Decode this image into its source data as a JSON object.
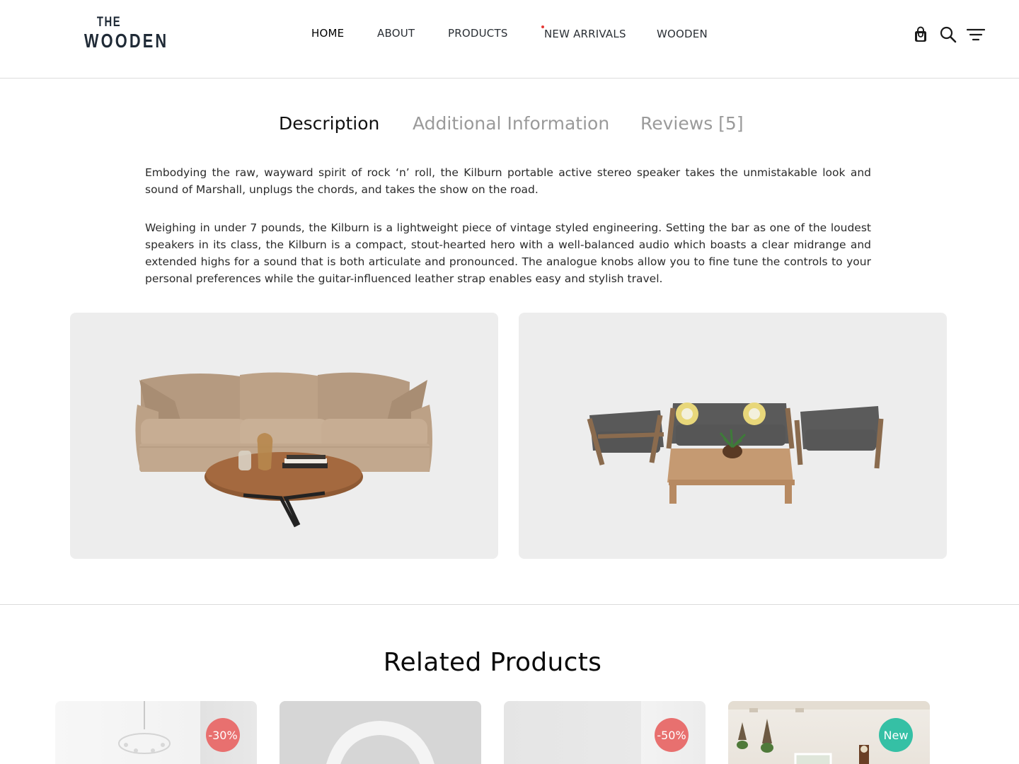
{
  "brand": {
    "line1": "THE",
    "line2": "WOODEN"
  },
  "nav": [
    {
      "label": "HOME"
    },
    {
      "label": "ABOUT"
    },
    {
      "label": "PRODUCTS"
    },
    {
      "label": "NEW ARRIVALS"
    },
    {
      "label": "WOODEN"
    }
  ],
  "header_icons": [
    "shopping-bag-icon",
    "search-icon",
    "filter-menu-icon"
  ],
  "tabs": [
    {
      "label": "Description",
      "active": true
    },
    {
      "label": "Additional Information",
      "active": false
    },
    {
      "label": "Reviews [5]",
      "active": false
    }
  ],
  "description": {
    "p1": "Embodying the raw, wayward spirit of rock ‘n’ roll, the Kilburn portable active stereo speaker takes the unmistakable look and sound of Marshall, unplugs the chords, and takes the show on the road.",
    "p2": "Weighing in under 7 pounds, the Kilburn is a lightweight piece of vintage styled engineering. Setting the bar as one of the loudest speakers in its class, the Kilburn is a compact, stout-hearted hero with a well-balanced audio which boasts a clear midrange and extended highs for a sound that is both articulate and pronounced. The analogue knobs allow you to fine tune the controls to your personal preferences while the guitar-influenced leather strap enables easy and stylish travel."
  },
  "related": {
    "title": "Related Products",
    "cards": [
      {
        "badge": "-30%",
        "badge_color": "#e8706f"
      },
      {
        "badge": "",
        "badge_color": ""
      },
      {
        "badge": "-50%",
        "badge_color": "#e8706f"
      },
      {
        "badge": "New",
        "badge_color": "#35c0a5"
      }
    ]
  },
  "colors": {
    "accent_dot": "#e53935",
    "panel_bg": "#ededed",
    "badge_sale": "#e8706f",
    "badge_new": "#35c0a5"
  }
}
